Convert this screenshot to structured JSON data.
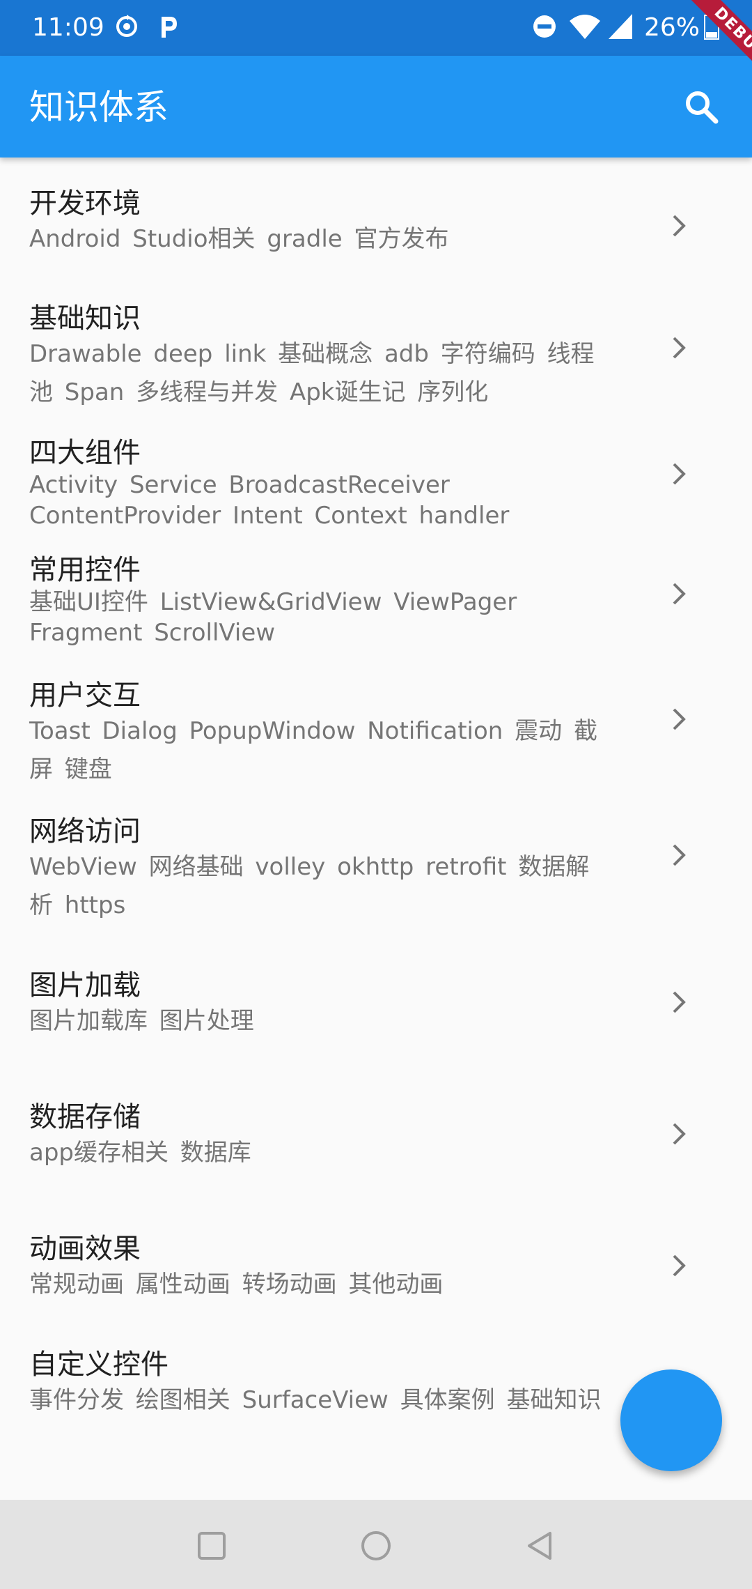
{
  "status_bar": {
    "time": "11:09",
    "battery_text": "26%",
    "icons": [
      "sync-icon",
      "parking-app-icon",
      "do-not-disturb-icon",
      "wifi-icon",
      "signal-icon",
      "battery-icon"
    ]
  },
  "debug_banner": "DEBUG",
  "app_bar": {
    "title": "知识体系",
    "search_icon": "search-icon"
  },
  "colors": {
    "primary": "#2196f3",
    "primary_dark": "#1976d2",
    "title_text": "#212121",
    "subtitle_text": "#757575",
    "debug_banner": "#b71c3a"
  },
  "list": {
    "items": [
      {
        "title": "开发环境",
        "subtitle": "Android Studio相关  gradle  官方发布"
      },
      {
        "title": "基础知识",
        "subtitle": "Drawable  deep link  基础概念  adb  字符编码  线程池  Span  多线程与并发  Apk诞生记  序列化"
      },
      {
        "title": "四大组件",
        "subtitle": "Activity  Service  BroadcastReceiver  ContentProvider  Intent  Context  handler"
      },
      {
        "title": "常用控件",
        "subtitle": "基础UI控件  ListView&GridView  ViewPager  Fragment  ScrollView"
      },
      {
        "title": "用户交互",
        "subtitle": "Toast  Dialog  PopupWindow  Notification  震动  截屏  键盘"
      },
      {
        "title": "网络访问",
        "subtitle": "WebView  网络基础  volley  okhttp  retrofit  数据解析  https"
      },
      {
        "title": "图片加载",
        "subtitle": "图片加载库  图片处理"
      },
      {
        "title": "数据存储",
        "subtitle": "app缓存相关  数据库"
      },
      {
        "title": "动画效果",
        "subtitle": "常规动画  属性动画  转场动画  其他动画"
      },
      {
        "title": "自定义控件",
        "subtitle": "事件分发  绘图相关  SurfaceView  具体案例  基础知识"
      }
    ]
  },
  "nav_bar": {
    "icons": [
      "recent-apps-icon",
      "home-icon",
      "back-icon"
    ]
  }
}
